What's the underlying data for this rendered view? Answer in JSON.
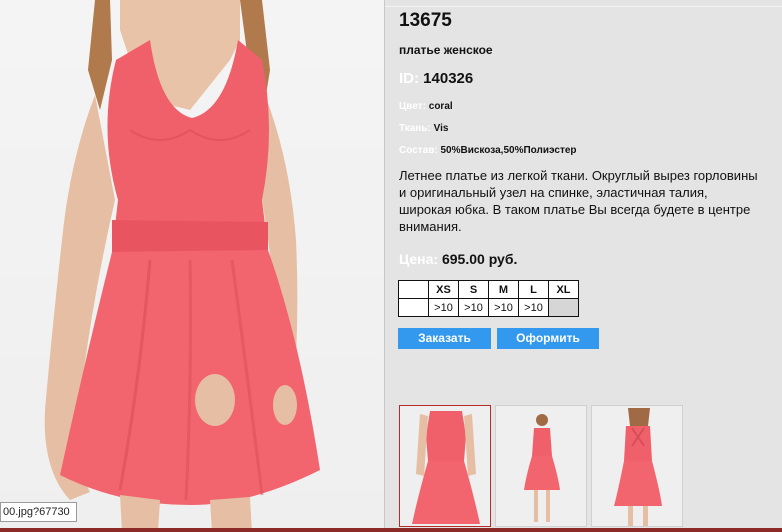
{
  "product": {
    "code": "13675",
    "subtitle": "платье женское",
    "id_label": "ID:",
    "id_value": "140326",
    "color_label": "Цвет:",
    "color_value": "coral",
    "fabric_label": "Ткань:",
    "fabric_value": "Vis",
    "composition_label": "Состав:",
    "composition_value": "50%Вискоза,50%Полиэстер",
    "description_lines": [
      "Летнее платье из легкой ткани. Округлый вырез горловины",
      "и оригинальный узел на спинке, эластичная талия,",
      "широкая юбка. В таком платье Вы всегда будете в центре",
      "внимания."
    ],
    "price_label": "Цена:",
    "price_value": "695.00 руб."
  },
  "sizes": {
    "headers": [
      "XS",
      "S",
      "M",
      "L",
      "XL"
    ],
    "stock": [
      ">10",
      ">10",
      ">10",
      ">10",
      ""
    ]
  },
  "buttons": {
    "order_label": "Заказать",
    "checkout_label": "Оформить"
  },
  "photo": {
    "tooltip_text": "00.jpg?67730",
    "dress_color": "#f0606a"
  },
  "thumbnails": [
    {
      "name": "front-closeup",
      "active": true
    },
    {
      "name": "front-full",
      "active": false
    },
    {
      "name": "back-full",
      "active": false
    }
  ],
  "colors": {
    "panel_bg": "#e4e4e4",
    "button_bg": "#3399ee",
    "active_thumb_border": "#b42a2a"
  }
}
